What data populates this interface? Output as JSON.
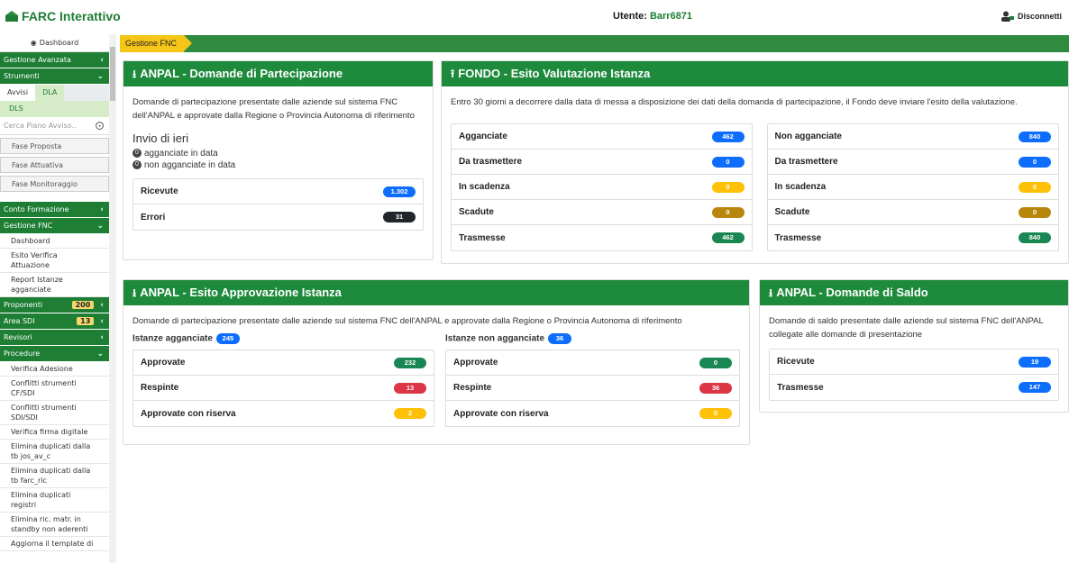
{
  "header": {
    "brand": "FARC Interattivo",
    "user_label": "Utente:",
    "user_value": "Barr6871",
    "logout": "Disconnetti"
  },
  "sidebar": {
    "dashboard": "Dashboard",
    "gestione_avanzata": "Gestione Avanzata",
    "strumenti": "Strumenti",
    "tabs": [
      "Avvisi",
      "DLA"
    ],
    "dls": "DLS",
    "search_placeholder": "Cerca Piano Avviso..",
    "buttons": [
      "Fase Proposta",
      "Fase Attuativa",
      "Fase Monitoraggio"
    ],
    "conto_formazione": "Conto Formazione",
    "gestione_fnc": "Gestione FNC",
    "fnc_items": [
      "Dashboard",
      "Esito Verifica Attuazione",
      "Report Istanze agganciate"
    ],
    "proponenti": "Proponenti",
    "proponenti_badge": "200",
    "area_sdi": "Area SDI",
    "area_sdi_badge": "13",
    "revisori": "Revisori",
    "procedure": "Procedure",
    "procedure_items": [
      "Verifica Adesione",
      "Conflitti strumenti CF/SDI",
      "Conflitti strumenti SDI/SDI",
      "Verifica firma digitale",
      "Elimina duplicati dalla tb jos_av_c",
      "Elimina duplicati dalla tb farc_ric",
      "Elimina duplicati registri",
      "Elimina ric. matr. in standby non aderenti",
      "Aggiorna il template di"
    ]
  },
  "breadcrumb": "Gestione FNC",
  "anpal_domande": {
    "title": "ANPAL - Domande di Partecipazione",
    "desc": "Domande di partecipazione presentate dalle aziende sul sistema FNC dell'ANPAL e approvate dalla Regione o Provincia Autonoma di riferimento",
    "invio_title": "Invio di ieri",
    "agganciate_count": "0",
    "agganciate_text": "agganciate in data",
    "non_agganciate_count": "0",
    "non_agganciate_text": "non agganciate in data",
    "ricevute_label": "Ricevute",
    "ricevute_value": "1.302",
    "errori_label": "Errori",
    "errori_value": "31"
  },
  "fondo": {
    "title": "FONDO - Esito Valutazione Istanza",
    "desc": "Entro 30 giorni a decorrere dalla data di messa a disposizione dei dati della domanda di partecipazione, il Fondo deve inviare l'esito della valutazione.",
    "left": [
      {
        "label": "Agganciate",
        "value": "462"
      },
      {
        "label": "Da trasmettere",
        "value": "0"
      },
      {
        "label": "In scadenza",
        "value": "0"
      },
      {
        "label": "Scadute",
        "value": "0"
      },
      {
        "label": "Trasmesse",
        "value": "462"
      }
    ],
    "right": [
      {
        "label": "Non agganciate",
        "value": "840"
      },
      {
        "label": "Da trasmettere",
        "value": "0"
      },
      {
        "label": "In scadenza",
        "value": "0"
      },
      {
        "label": "Scadute",
        "value": "0"
      },
      {
        "label": "Trasmesse",
        "value": "840"
      }
    ]
  },
  "esito": {
    "title": "ANPAL - Esito Approvazione Istanza",
    "desc": "Domande di partecipazione presentate dalle aziende sul sistema FNC dell'ANPAL e approvate dalla Regione o Provincia Autonoma di riferimento",
    "agganciate_label": "Istanze agganciate",
    "agganciate_value": "245",
    "non_agganciate_label": "Istanze non agganciate",
    "non_agganciate_value": "36",
    "left": [
      {
        "label": "Approvate",
        "value": "232"
      },
      {
        "label": "Respinte",
        "value": "13"
      },
      {
        "label": "Approvate con riserva",
        "value": "2"
      }
    ],
    "right": [
      {
        "label": "Approvate",
        "value": "0"
      },
      {
        "label": "Respinte",
        "value": "36"
      },
      {
        "label": "Approvate con riserva",
        "value": "0"
      }
    ]
  },
  "saldo": {
    "title": "ANPAL - Domande di Saldo",
    "desc": "Domande di saldo presentate dalle aziende sul sistema FNC dell'ANPAL collegate alle domande di presentazione",
    "ricevute_label": "Ricevute",
    "ricevute_value": "19",
    "trasmesse_label": "Trasmesse",
    "trasmesse_value": "147"
  },
  "colors": {
    "brand_green": "#1e8a3c",
    "blue": "#0d6efd",
    "yellow": "#ffc107",
    "brown": "#b8860b",
    "green": "#198754",
    "red": "#dc3545",
    "dark": "#212529"
  }
}
